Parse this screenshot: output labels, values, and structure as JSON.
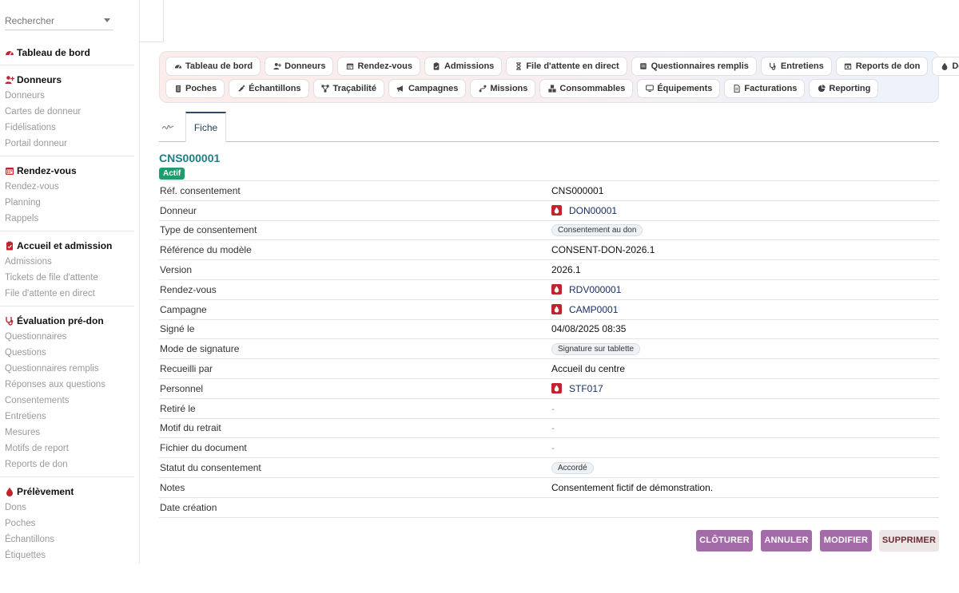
{
  "sidebar": {
    "search_placeholder": "Rechercher",
    "sections": [
      {
        "title": "Tableau de bord",
        "icon": "gauge-icon",
        "items": []
      },
      {
        "title": "Donneurs",
        "icon": "user-plus-icon",
        "items": [
          "Donneurs",
          "Cartes de donneur",
          "Fidélisations",
          "Portail donneur"
        ]
      },
      {
        "title": "Rendez-vous",
        "icon": "calendar-icon",
        "items": [
          "Rendez-vous",
          "Planning",
          "Rappels"
        ]
      },
      {
        "title": "Accueil et admission",
        "icon": "clipboard-icon",
        "items": [
          "Admissions",
          "Tickets de file d'attente",
          "File d'attente en direct"
        ]
      },
      {
        "title": "Évaluation pré-don",
        "icon": "stethoscope-icon",
        "items": [
          "Questionnaires",
          "Questions",
          "Questionnaires remplis",
          "Réponses aux questions",
          "Consentements",
          "Entretiens",
          "Mesures",
          "Motifs de report",
          "Reports de don"
        ]
      },
      {
        "title": "Prélèvement",
        "icon": "drop-icon",
        "items": [
          "Dons",
          "Poches",
          "Échantillons",
          "Étiquettes"
        ]
      }
    ]
  },
  "modules": {
    "row1": [
      {
        "label": "Tableau de bord",
        "icon": "gauge-icon"
      },
      {
        "label": "Donneurs",
        "icon": "user-plus-icon"
      },
      {
        "label": "Rendez-vous",
        "icon": "calendar-icon"
      },
      {
        "label": "Admissions",
        "icon": "clipboard-icon"
      },
      {
        "label": "File d'attente en direct",
        "icon": "hourglass-icon"
      },
      {
        "label": "Questionnaires remplis",
        "icon": "form-icon"
      },
      {
        "label": "Entretiens",
        "icon": "stethoscope-icon"
      },
      {
        "label": "Reports de don",
        "icon": "calendar-x-icon"
      },
      {
        "label": "Dons",
        "icon": "drop-icon"
      }
    ],
    "row2": [
      {
        "label": "Poches",
        "icon": "bag-icon"
      },
      {
        "label": "Échantillons",
        "icon": "syringe-icon"
      },
      {
        "label": "Traçabilité",
        "icon": "network-icon"
      },
      {
        "label": "Campagnes",
        "icon": "megaphone-icon"
      },
      {
        "label": "Missions",
        "icon": "route-icon"
      },
      {
        "label": "Consommables",
        "icon": "boxes-icon"
      },
      {
        "label": "Équipements",
        "icon": "monitor-icon"
      },
      {
        "label": "Facturations",
        "icon": "invoice-icon"
      },
      {
        "label": "Reporting",
        "icon": "pie-icon"
      }
    ]
  },
  "tabs": {
    "fiche": "Fiche"
  },
  "record": {
    "title": "CNS000001",
    "status_badge": "Actif",
    "fields": [
      {
        "label": "Réf. consentement",
        "value": "CNS000001",
        "kind": "text"
      },
      {
        "label": "Donneur",
        "value": "DON00001",
        "kind": "link"
      },
      {
        "label": "Type de consentement",
        "value": "Consentement au don",
        "kind": "chip"
      },
      {
        "label": "Référence du modèle",
        "value": "CONSENT-DON-2026.1",
        "kind": "text"
      },
      {
        "label": "Version",
        "value": "2026.1",
        "kind": "text"
      },
      {
        "label": "Rendez-vous",
        "value": "RDV000001",
        "kind": "link"
      },
      {
        "label": "Campagne",
        "value": "CAMP0001",
        "kind": "link"
      },
      {
        "label": "Signé le",
        "value": "04/08/2025 08:35",
        "kind": "text"
      },
      {
        "label": "Mode de signature",
        "value": "Signature sur tablette",
        "kind": "chip"
      },
      {
        "label": "Recueilli par",
        "value": "Accueil du centre",
        "kind": "text"
      },
      {
        "label": "Personnel",
        "value": "STF017",
        "kind": "link"
      },
      {
        "label": "Retiré le",
        "value": "-",
        "kind": "dash"
      },
      {
        "label": "Motif du retrait",
        "value": "-",
        "kind": "dash"
      },
      {
        "label": "Fichier du document",
        "value": "-",
        "kind": "dash"
      },
      {
        "label": "Statut du consentement",
        "value": "Accordé",
        "kind": "chip"
      },
      {
        "label": "Notes",
        "value": "Consentement fictif de démonstration.",
        "kind": "text"
      },
      {
        "label": "Date création",
        "value": "",
        "kind": "text"
      }
    ]
  },
  "actions": {
    "cloturer": "CLÔTURER",
    "annuler": "ANNULER",
    "modifier": "MODIFIER",
    "supprimer": "SUPPRIMER"
  },
  "colors": {
    "accent_red": "#c0242e",
    "title_teal": "#1e7d87",
    "badge_green": "#1f9c6e",
    "action_purple": "#a36ba8",
    "link_navy": "#1a2f63"
  }
}
